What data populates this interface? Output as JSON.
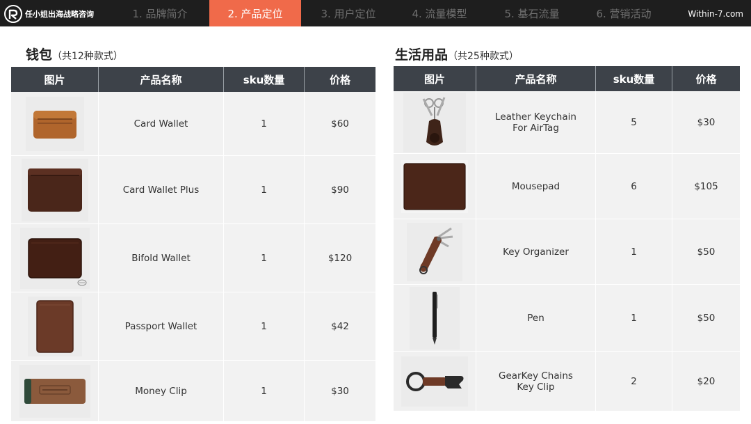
{
  "header": {
    "brand": "任小姐出海战略咨询",
    "tabs": [
      {
        "label": "1. 品牌简介",
        "active": false
      },
      {
        "label": "2. 产品定位",
        "active": true
      },
      {
        "label": "3. 用户定位",
        "active": false
      },
      {
        "label": "4. 流量模型",
        "active": false
      },
      {
        "label": "5. 基石流量",
        "active": false
      },
      {
        "label": "6. 营销活动",
        "active": false
      }
    ],
    "site": "Within-7.com"
  },
  "colors": {
    "nav_bg": "#1e1e1e",
    "accent": "#f06a4a",
    "table_header": "#3d4249",
    "row_bg": "#f2f2f2"
  },
  "wallets": {
    "title": "钱包",
    "subtitle": "（共12种款式）",
    "columns": [
      "图片",
      "产品名称",
      "sku数量",
      "价格"
    ],
    "rows": [
      {
        "image": "card-wallet-image",
        "name": [
          "Card Wallet"
        ],
        "sku": "1",
        "price": "$60"
      },
      {
        "image": "card-wallet-plus-image",
        "name": [
          "Card Wallet Plus"
        ],
        "sku": "1",
        "price": "$90"
      },
      {
        "image": "bifold-wallet-image",
        "name": [
          "Bifold Wallet"
        ],
        "sku": "1",
        "price": "$120"
      },
      {
        "image": "passport-wallet-image",
        "name": [
          "Passport Wallet"
        ],
        "sku": "1",
        "price": "$42"
      },
      {
        "image": "money-clip-image",
        "name": [
          "Money Clip"
        ],
        "sku": "1",
        "price": "$30"
      }
    ]
  },
  "lifestyle": {
    "title": "生活用品",
    "subtitle": "（共25种款式）",
    "columns": [
      "图片",
      "产品名称",
      "sku数量",
      "价格"
    ],
    "rows": [
      {
        "image": "keychain-image",
        "name": [
          "Leather Keychain",
          "For AirTag"
        ],
        "sku": "5",
        "price": "$30"
      },
      {
        "image": "mousepad-image",
        "name": [
          "Mousepad"
        ],
        "sku": "6",
        "price": "$105"
      },
      {
        "image": "key-organizer-image",
        "name": [
          "Key Organizer"
        ],
        "sku": "1",
        "price": "$50"
      },
      {
        "image": "pen-image",
        "name": [
          "Pen"
        ],
        "sku": "1",
        "price": "$50"
      },
      {
        "image": "gearkey-image",
        "name": [
          "GearKey Chains",
          "Key Clip"
        ],
        "sku": "2",
        "price": "$20"
      }
    ]
  }
}
